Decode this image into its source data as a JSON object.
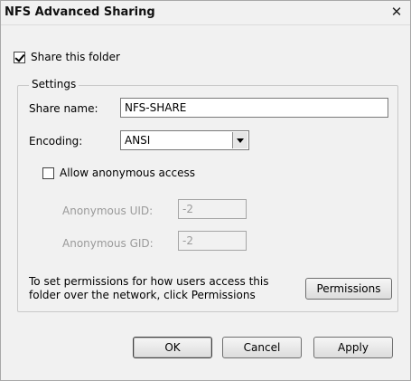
{
  "window": {
    "title": "NFS Advanced Sharing",
    "close_glyph": "✕"
  },
  "share_folder": {
    "label": "Share this folder",
    "checked": true
  },
  "settings": {
    "legend": "Settings",
    "share_name_label": "Share name:",
    "share_name_value": "NFS-SHARE",
    "encoding_label": "Encoding:",
    "encoding_value": "ANSI",
    "anonymous_label": "Allow anonymous access",
    "anonymous_checked": false,
    "uid_label": "Anonymous UID:",
    "uid_value": "-2",
    "gid_label": "Anonymous GID:",
    "gid_value": "-2",
    "permissions_text_1": "To set permissions for how users access this",
    "permissions_text_2": "folder over the network, click Permissions",
    "permissions_button": "Permissions"
  },
  "footer": {
    "ok": "OK",
    "cancel": "Cancel",
    "apply": "Apply"
  }
}
